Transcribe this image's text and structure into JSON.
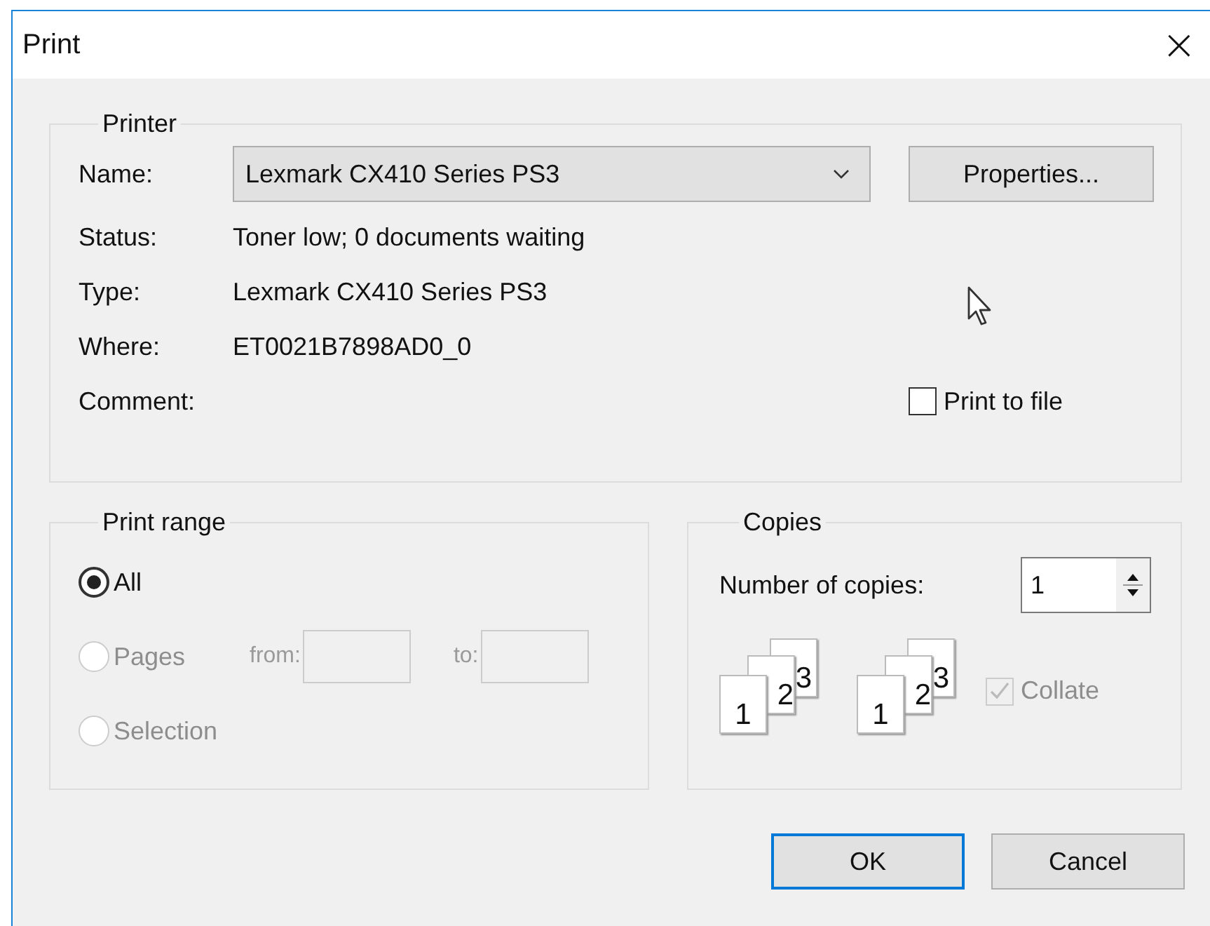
{
  "window": {
    "title": "Print",
    "close": "×"
  },
  "printer": {
    "legend": "Printer",
    "name_label": "Name:",
    "name_value": "Lexmark CX410 Series PS3",
    "properties_button": "Properties...",
    "info": [
      {
        "label": "Status:",
        "value": "Toner low; 0 documents waiting"
      },
      {
        "label": "Type:",
        "value": "Lexmark CX410 Series PS3"
      },
      {
        "label": "Where:",
        "value": "ET0021B7898AD0_0"
      },
      {
        "label": "Comment:"
      }
    ],
    "print_to_file": {
      "label": "Print to file",
      "checked": false
    }
  },
  "print_range": {
    "legend": "Print range",
    "options": [
      {
        "label": "All",
        "selected": true,
        "disabled": false
      },
      {
        "label": "Pages",
        "selected": false,
        "disabled": true
      },
      {
        "label": "Selection",
        "selected": false,
        "disabled": true
      }
    ],
    "from_label": "from:",
    "to_label": "to:",
    "fields_disabled": true
  },
  "copies": {
    "legend": "Copies",
    "number_label": "Number of copies:",
    "number_value": "1",
    "collate_stacks": [
      [
        "1",
        "2",
        "3"
      ],
      [
        "1",
        "2",
        "3"
      ]
    ],
    "collate": {
      "label": "Collate",
      "checked": true,
      "disabled": true
    }
  },
  "buttons": [
    {
      "label": "OK",
      "default": true
    },
    {
      "label": "Cancel",
      "default": false
    }
  ]
}
